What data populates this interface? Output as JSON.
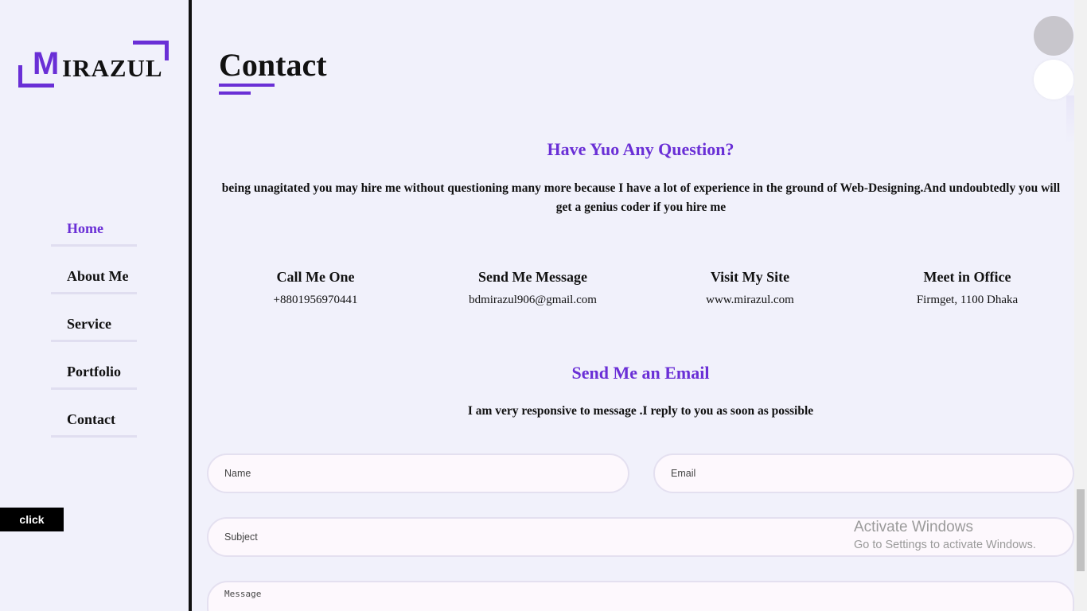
{
  "logo": {
    "first_letter": "M",
    "rest": "IRAZUL"
  },
  "nav": [
    {
      "label": "Home",
      "active": true
    },
    {
      "label": "About Me",
      "active": false
    },
    {
      "label": "Service",
      "active": false
    },
    {
      "label": "Portfolio",
      "active": false
    },
    {
      "label": "Contact",
      "active": false
    }
  ],
  "click_button": "click",
  "page_title": "Contact",
  "question_heading": "Have Yuo Any Question?",
  "question_text": "being unagitated you may hire me without questioning many more because I have a lot of experience in the ground of Web-Designing.And undoubtedly you will get a genius coder if you hire me",
  "contact_info": [
    {
      "title": "Call Me One",
      "value": "+8801956970441"
    },
    {
      "title": "Send Me Message",
      "value": "bdmirazul906@gmail.com"
    },
    {
      "title": "Visit My Site",
      "value": "www.mirazul.com"
    },
    {
      "title": "Meet in Office",
      "value": "Firmget, 1100 Dhaka"
    }
  ],
  "email_heading": "Send Me an Email",
  "email_text": "I am very responsive to message .I reply to you as soon as possible",
  "form": {
    "name_placeholder": "Name",
    "email_placeholder": "Email",
    "subject_placeholder": "Subject",
    "message_placeholder": "Message"
  },
  "watermark": {
    "line1": "Activate Windows",
    "line2": "Go to Settings to activate Windows."
  },
  "colors": {
    "accent": "#6a2fd6",
    "background": "#f1f1fb"
  }
}
